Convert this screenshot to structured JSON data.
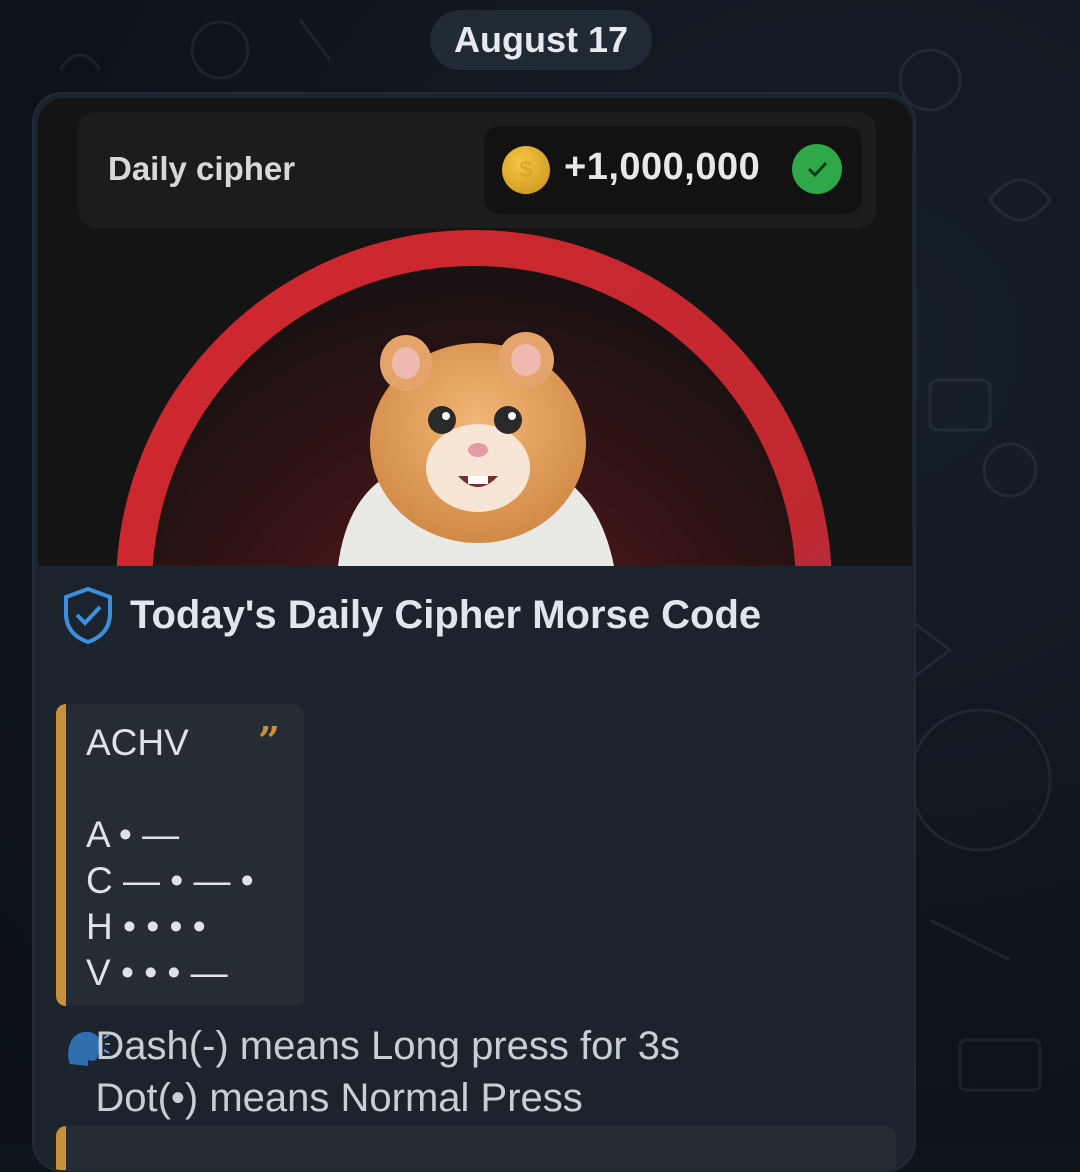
{
  "date_separator": "August 17",
  "card": {
    "label": "Daily cipher",
    "reward": "+1,000,000",
    "coin_symbol": "$"
  },
  "message": {
    "title": "Today's Daily Cipher Morse Code",
    "quote_lines": "ACHV\n\nA • —\nC — • — •\nH • • • •\nV • • • —",
    "quote_mark": "”",
    "note": "   Dash(-) means Long press for 3s\n   Dot(•) means Normal Press"
  },
  "colors": {
    "accent": "#c8913b",
    "check_green": "#2fa84a",
    "shield_blue": "#3d8fe0",
    "ring_red": "#c0282f"
  },
  "icons": [
    "coin-icon",
    "check-icon",
    "shield-check-icon",
    "quote-icon",
    "speaking-head-icon"
  ]
}
